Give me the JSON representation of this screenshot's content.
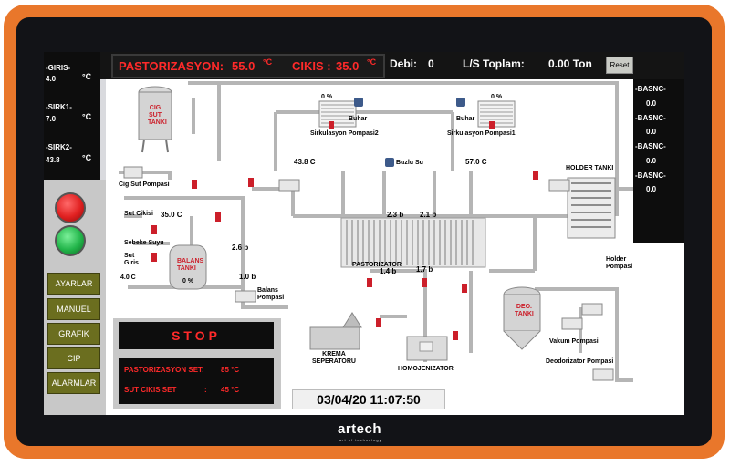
{
  "top_bar": {
    "pasteurization_label": "PASTORIZASYON:",
    "pasteurization_value": "55.0",
    "pasteurization_unit": "°C",
    "outlet_label": "CIKIS :",
    "outlet_value": "35.0",
    "outlet_unit": "°C",
    "flow_label": "Debi:",
    "flow_value": "0",
    "total_label": "L/S  Toplam:",
    "total_value": "0.00 Ton",
    "reset_label": "Reset"
  },
  "left_sensors": [
    {
      "label": "-GIRIS-",
      "value": "4.0",
      "unit": "°C"
    },
    {
      "label": "-SIRK1-",
      "value": "7.0",
      "unit": "°C"
    },
    {
      "label": "-SIRK2-",
      "value": "43.8",
      "unit": "°C"
    }
  ],
  "right_sensors": [
    {
      "label": "-BASNC-",
      "value": "0.0"
    },
    {
      "label": "-BASNC-",
      "value": "0.0"
    },
    {
      "label": "-BASNC-",
      "value": "0.0"
    },
    {
      "label": "-BASNC-",
      "value": "0.0"
    }
  ],
  "menu": [
    "AYARLAR",
    "MANUEL",
    "GRAFIK",
    "CIP",
    "ALARMLAR"
  ],
  "status": {
    "state": "STOP",
    "past_set_label": "PASTORIZASYON SET:",
    "past_set_value": "85 °C",
    "outlet_set_label": "SUT CIKIS SET",
    "outlet_set_sep": ":",
    "outlet_set_value": "45 °C"
  },
  "datetime": "03/04/20 11:07:50",
  "diagram": {
    "raw_milk_tank": [
      "CIG",
      "SUT",
      "TANKI"
    ],
    "raw_milk_pump": "Cig Sut Pompasi",
    "milk_outlet": "Sut Cikisi",
    "milk_outlet_temp": "35.0 C",
    "mains_water": "Sebeke Suyu",
    "milk_inlet": [
      "Sut",
      "Giris"
    ],
    "inlet_temp": "4.0 C",
    "balance_tank": [
      "BALANS",
      "TANKI"
    ],
    "balance_pct": "0 %",
    "balance_pump": [
      "Balans",
      "Pompasi"
    ],
    "pressure_1": "2.6 b",
    "pressure_2": "1.0 b",
    "steam_1": "Buhar",
    "steam_1_pct": "0 %",
    "circ_pump_2": "Sirkulasyon Pompasi2",
    "circ_2_temp": "43.8 C",
    "ice_water": "Buzlu Su",
    "steam_2": "Buhar",
    "steam_2_pct": "0 %",
    "circ_pump_1": "Sirkulasyon Pompasi1",
    "circ_1_temp": "57.0 C",
    "holder_tank": "HOLDER TANKI",
    "holder_pump": [
      "Holder",
      "Pompasi"
    ],
    "pasteurizer": "PASTORIZATOR",
    "pressure_3": "2.3 b",
    "pressure_4": "2.1 b",
    "pressure_5": "1.4 b",
    "pressure_6": "1.7 b",
    "cream_separator": [
      "KREMA",
      "SEPERATORU"
    ],
    "homogenizer": "HOMOJENIZATOR",
    "deo_tank": [
      "DEO.",
      "TANKI"
    ],
    "vacuum_pump": "Vakum Pompasi",
    "deodorizer_pump": "Deodorizator Pompasi"
  },
  "logo": {
    "brand": "artech",
    "slogan": "art of technology"
  },
  "colors": {
    "bezel": "#e9772b",
    "alarm_red": "#ff2a2a",
    "menu_olive": "#6b6e1f",
    "pipe": "#b9b9b9",
    "lamp_red": "#e02020",
    "lamp_green": "#22b54a"
  }
}
